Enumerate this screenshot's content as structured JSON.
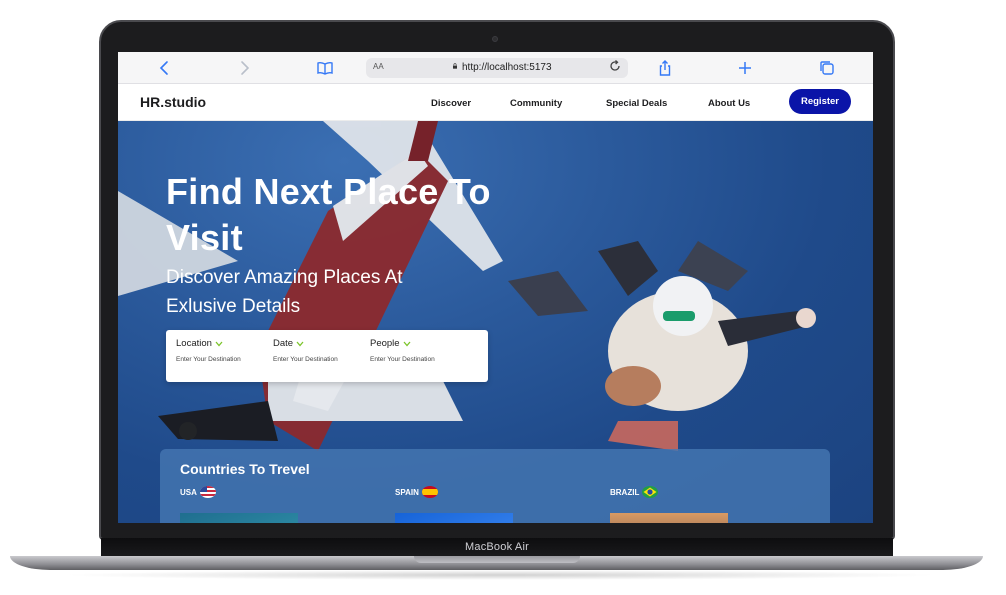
{
  "browser": {
    "text_size": "AA",
    "url": "http://localhost:5173",
    "icons": [
      "back-icon",
      "forward-icon",
      "reader-icon",
      "reload-icon",
      "share-icon",
      "new-tab-icon",
      "tabs-icon"
    ]
  },
  "site": {
    "logo": "HR.studio",
    "nav": [
      "Discover",
      "Community",
      "Special Deals",
      "About Us"
    ],
    "register": "Register"
  },
  "hero": {
    "title": "Find Next Place To Visit",
    "subtitle": "Discover Amazing Places At Exlusive Details",
    "search": [
      {
        "label": "Location",
        "placeholder": "Enter Your Destination"
      },
      {
        "label": "Date",
        "placeholder": "Enter Your Destination"
      },
      {
        "label": "People",
        "placeholder": "Enter Your Destination"
      }
    ],
    "accent_color": "#7cc52b"
  },
  "countries": {
    "title": "Countries To Trevel",
    "items": [
      {
        "name": "USA",
        "flag": "us-flag-icon"
      },
      {
        "name": "SPAIN",
        "flag": "spain-flag-icon"
      },
      {
        "name": "BRAZIL",
        "flag": "brazil-flag-icon"
      }
    ]
  },
  "device": {
    "label": "MacBook Air"
  },
  "colors": {
    "brand_button": "#0a14a8",
    "hero_blue": "#2b5a9c",
    "link_blue": "#3478f6"
  }
}
